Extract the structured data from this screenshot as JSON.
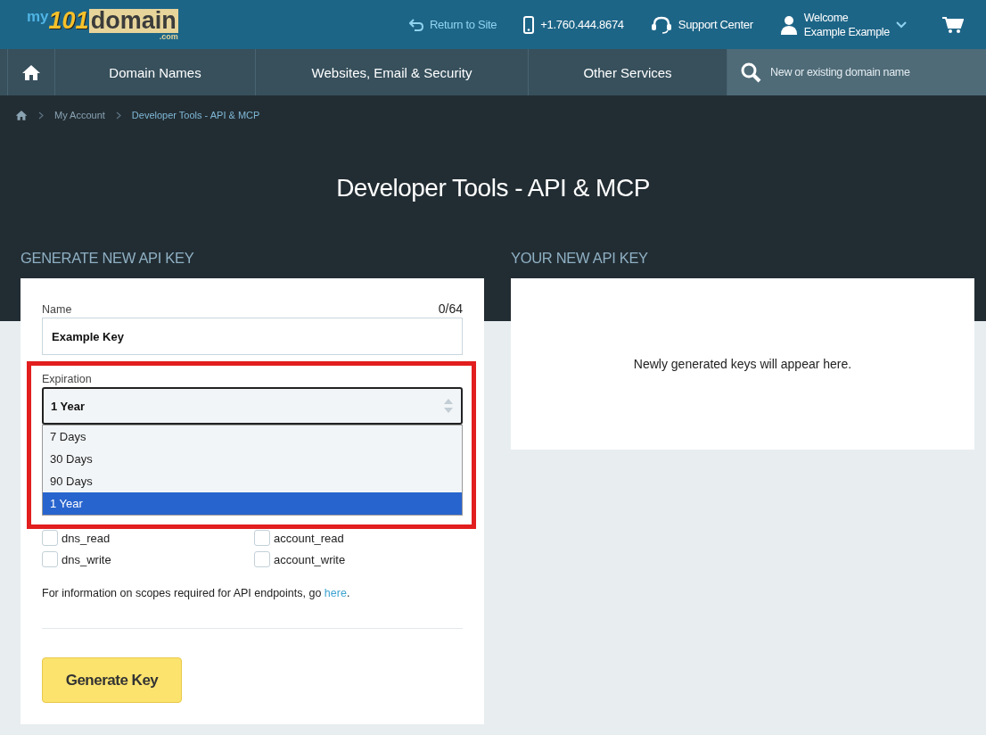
{
  "header": {
    "logo": {
      "prefix": "my",
      "number": "101",
      "word": "domain",
      "suffix": ".com"
    },
    "return_link": "Return to Site",
    "phone": "+1.760.444.8674",
    "support": "Support Center",
    "user": {
      "greeting": "Welcome",
      "name": "Example Example"
    }
  },
  "nav": {
    "items": [
      "Domain Names",
      "Websites, Email & Security",
      "Other Services"
    ],
    "search": {
      "placeholder": "New or existing domain name"
    }
  },
  "breadcrumb": [
    "My Account",
    "Developer Tools - API & MCP"
  ],
  "page_title": "Developer Tools - API & MCP",
  "generate": {
    "heading": "GENERATE NEW API KEY",
    "name_label": "Name",
    "counter": "0/64",
    "name_value": "Example Key",
    "expiration_label": "Expiration",
    "expiration_value": "1 Year",
    "options": [
      {
        "label": "7 Days",
        "selected": false
      },
      {
        "label": "30 Days",
        "selected": false
      },
      {
        "label": "90 Days",
        "selected": false
      },
      {
        "label": "1 Year",
        "selected": true
      }
    ],
    "scopes": [
      {
        "label": "dns_read",
        "checked": false
      },
      {
        "label": "account_read",
        "checked": false
      },
      {
        "label": "dns_write",
        "checked": false
      },
      {
        "label": "account_write",
        "checked": false
      }
    ],
    "info": {
      "text": "For information on scopes required for API endpoints, go ",
      "link": "here",
      "end": "."
    },
    "button": "Generate Key"
  },
  "result": {
    "heading": "YOUR NEW API KEY",
    "empty_text": "Newly generated keys will appear here."
  }
}
